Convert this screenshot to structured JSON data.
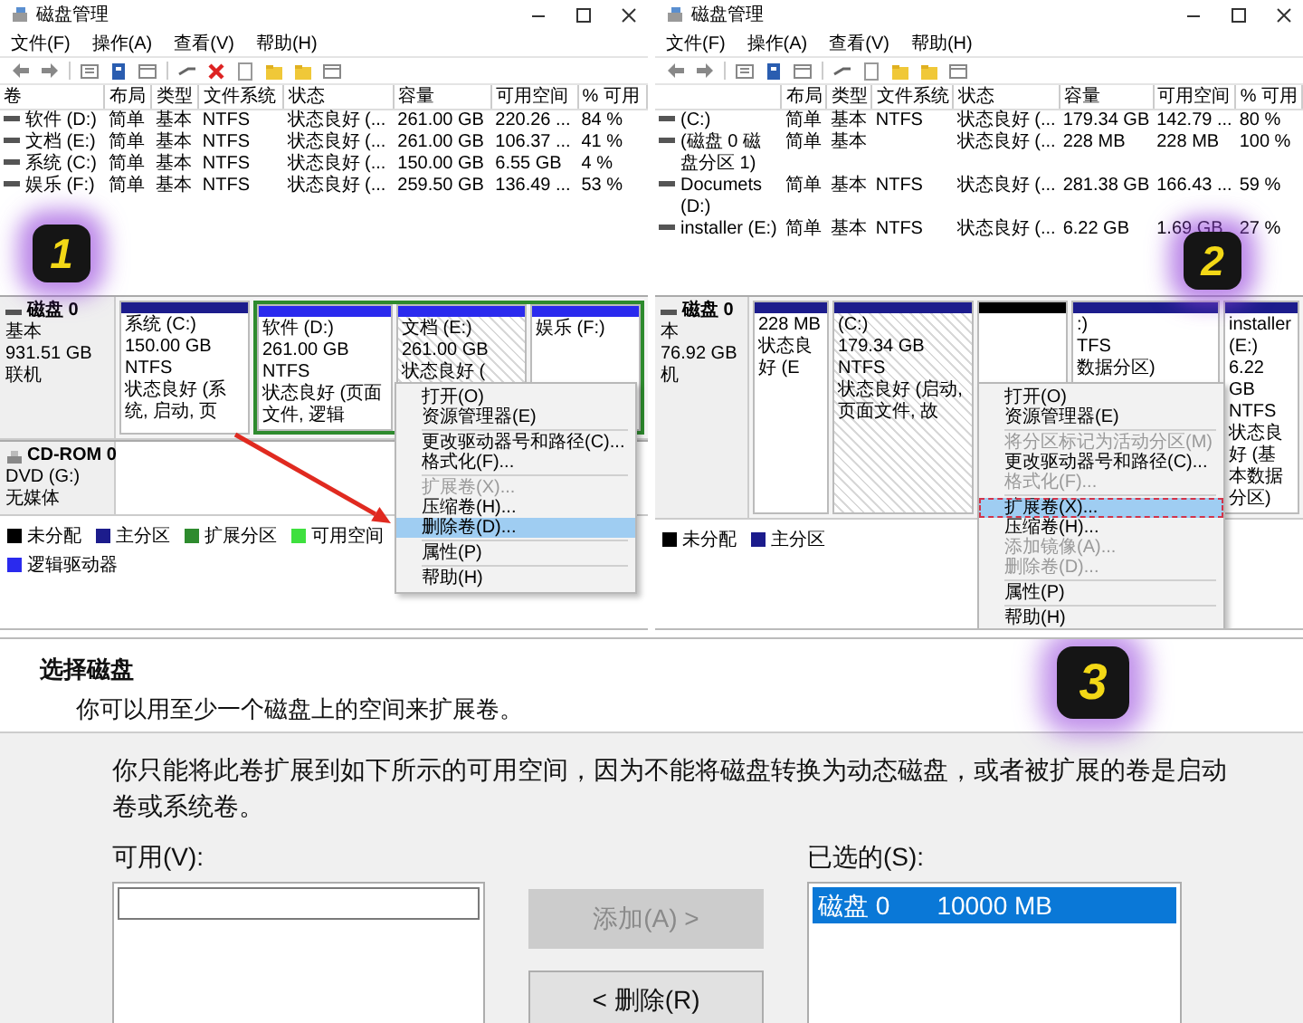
{
  "panels": [
    {
      "title": "磁盘管理",
      "menu": [
        "文件(F)",
        "操作(A)",
        "查看(V)",
        "帮助(H)"
      ],
      "volume_table": {
        "volume_column": "卷",
        "columns": [
          "布局",
          "类型",
          "文件系统",
          "状态",
          "容量",
          "可用空间",
          "% 可用"
        ],
        "rows": [
          {
            "volume": "软件 (D:)",
            "layout": "简单",
            "type": "基本",
            "file_system": "NTFS",
            "status": "状态良好 (...",
            "capacity": "261.00 GB",
            "free": "220.26 ...",
            "percent_free": "84 %"
          },
          {
            "volume": "文档 (E:)",
            "layout": "简单",
            "type": "基本",
            "file_system": "NTFS",
            "status": "状态良好 (...",
            "capacity": "261.00 GB",
            "free": "106.37 ...",
            "percent_free": "41 %"
          },
          {
            "volume": "系统 (C:)",
            "layout": "简单",
            "type": "基本",
            "file_system": "NTFS",
            "status": "状态良好 (...",
            "capacity": "150.00 GB",
            "free": "6.55 GB",
            "percent_free": "4 %"
          },
          {
            "volume": "娱乐 (F:)",
            "layout": "简单",
            "type": "基本",
            "file_system": "NTFS",
            "status": "状态良好 (...",
            "capacity": "259.50 GB",
            "free": "136.49 ...",
            "percent_free": "53 %"
          }
        ]
      },
      "disks": [
        {
          "kind": "disk",
          "lines": [
            "磁盘 0",
            "基本",
            "931.51 GB",
            "联机"
          ],
          "partitions": [
            {
              "kind": "primary",
              "name": "系统 (C:)",
              "lines": [
                "150.00 GB NTFS",
                "状态良好 (系统, 启动, 页"
              ],
              "selected": false
            },
            {
              "kind": "logical",
              "name": "软件 (D:)",
              "lines": [
                "261.00 GB NTFS",
                "状态良好 (页面文件, 逻辑"
              ],
              "selected": false
            },
            {
              "kind": "logical",
              "name": "文档 (E:)",
              "lines": [
                "261.00 GB",
                "状态良好 ("
              ],
              "selected": true
            },
            {
              "kind": "logical",
              "name": "娱乐 (F:)",
              "selected": false
            }
          ]
        },
        {
          "kind": "cdrom",
          "lines": [
            "CD-ROM 0",
            "DVD (G:)",
            "无媒体"
          ]
        }
      ],
      "legend": [
        {
          "label": "未分配",
          "color": "#000000"
        },
        {
          "label": "主分区",
          "color": "#1c1c8c"
        },
        {
          "label": "扩展分区",
          "color": "#2e8b2e"
        },
        {
          "label": "可用空间",
          "color": "#3ee03e"
        },
        {
          "label": "逻辑驱动器",
          "color": "#2a2aee"
        }
      ],
      "context_menu": {
        "items": [
          {
            "kind": "item",
            "label": "打开(O)",
            "disabled": false,
            "selected": false,
            "outlined": false
          },
          {
            "kind": "item",
            "label": "资源管理器(E)",
            "disabled": false,
            "selected": false,
            "outlined": false
          },
          {
            "kind": "separator"
          },
          {
            "kind": "item",
            "label": "更改驱动器号和路径(C)...",
            "disabled": false,
            "selected": false,
            "outlined": false
          },
          {
            "kind": "item",
            "label": "格式化(F)...",
            "disabled": false,
            "selected": false,
            "outlined": false
          },
          {
            "kind": "separator"
          },
          {
            "kind": "item",
            "label": "扩展卷(X)...",
            "disabled": true,
            "selected": false,
            "outlined": false
          },
          {
            "kind": "item",
            "label": "压缩卷(H)...",
            "disabled": false,
            "selected": false,
            "outlined": false
          },
          {
            "kind": "item",
            "label": "删除卷(D)...",
            "disabled": false,
            "selected": true,
            "outlined": false
          },
          {
            "kind": "separator"
          },
          {
            "kind": "item",
            "label": "属性(P)",
            "disabled": false,
            "selected": false,
            "outlined": false
          },
          {
            "kind": "separator"
          },
          {
            "kind": "item",
            "label": "帮助(H)",
            "disabled": false,
            "selected": false,
            "outlined": false
          }
        ]
      },
      "arrow": true,
      "badge": "1"
    },
    {
      "title": "磁盘管理",
      "menu": [
        "文件(F)",
        "操作(A)",
        "查看(V)",
        "帮助(H)"
      ],
      "volume_table": {
        "columns": [
          "布局",
          "类型",
          "文件系统",
          "状态",
          "容量",
          "可用空间",
          "% 可用"
        ],
        "rows": [
          {
            "volume": "(C:)",
            "layout": "简单",
            "type": "基本",
            "file_system": "NTFS",
            "status": "状态良好 (...",
            "capacity": "179.34 GB",
            "free": "142.79 ...",
            "percent_free": "80 %"
          },
          {
            "volume": "(磁盘 0 磁盘分区 1)",
            "layout": "简单",
            "type": "基本",
            "status": "状态良好 (...",
            "capacity": "228 MB",
            "free": "228 MB",
            "percent_free": "100 %"
          },
          {
            "volume": "Documets (D:)",
            "layout": "简单",
            "type": "基本",
            "file_system": "NTFS",
            "status": "状态良好 (...",
            "capacity": "281.38 GB",
            "free": "166.43 ...",
            "percent_free": "59 %"
          },
          {
            "volume": "installer (E:)",
            "layout": "简单",
            "type": "基本",
            "file_system": "NTFS",
            "status": "状态良好 (...",
            "capacity": "6.22 GB",
            "free": "1.69 GB",
            "percent_free": "27 %"
          }
        ]
      },
      "disks": [
        {
          "kind": "disk",
          "lines": [
            "磁盘 0",
            "本",
            "76.92 GB",
            "机"
          ],
          "partitions": [
            {
              "kind": "primary",
              "lines": [
                "228 MB",
                "状态良好 (E"
              ],
              "selected": false
            },
            {
              "kind": "primary",
              "name": "(C:)",
              "lines": [
                "179.34 GB NTFS",
                "状态良好 (启动, 页面文件, 故"
              ],
              "selected": true
            },
            {
              "kind": "unallocated",
              "selected": false
            },
            {
              "kind": "primary",
              "name": ":)",
              "lines": [
                "TFS",
                "数据分区)"
              ],
              "selected": false
            },
            {
              "kind": "primary",
              "name": "installer (E:)",
              "lines": [
                "6.22 GB NTFS",
                "状态良好 (基本数据分区)"
              ],
              "selected": false
            }
          ]
        }
      ],
      "legend": [
        {
          "label": "未分配",
          "color": "#000000"
        },
        {
          "label": "主分区",
          "color": "#1c1c8c"
        }
      ],
      "context_menu": {
        "items": [
          {
            "kind": "item",
            "label": "打开(O)",
            "disabled": false,
            "selected": false,
            "outlined": false
          },
          {
            "kind": "item",
            "label": "资源管理器(E)",
            "disabled": false,
            "selected": false,
            "outlined": false
          },
          {
            "kind": "separator"
          },
          {
            "kind": "item",
            "label": "将分区标记为活动分区(M)",
            "disabled": true,
            "selected": false,
            "outlined": false
          },
          {
            "kind": "item",
            "label": "更改驱动器号和路径(C)...",
            "disabled": false,
            "selected": false,
            "outlined": false
          },
          {
            "kind": "item",
            "label": "格式化(F)...",
            "disabled": true,
            "selected": false,
            "outlined": false
          },
          {
            "kind": "separator"
          },
          {
            "kind": "item",
            "label": "扩展卷(X)...",
            "disabled": false,
            "selected": true,
            "outlined": true
          },
          {
            "kind": "item",
            "label": "压缩卷(H)...",
            "disabled": false,
            "selected": false,
            "outlined": false
          },
          {
            "kind": "item",
            "label": "添加镜像(A)...",
            "disabled": true,
            "selected": false,
            "outlined": false
          },
          {
            "kind": "item",
            "label": "删除卷(D)...",
            "disabled": true,
            "selected": false,
            "outlined": false
          },
          {
            "kind": "separator"
          },
          {
            "kind": "item",
            "label": "属性(P)",
            "disabled": false,
            "selected": false,
            "outlined": false
          },
          {
            "kind": "separator"
          },
          {
            "kind": "item",
            "label": "帮助(H)",
            "disabled": false,
            "selected": false,
            "outlined": false
          }
        ]
      },
      "badge": "2"
    }
  ],
  "dialog": {
    "heading": "选择磁盘",
    "subheading": "你可以用至少一个磁盘上的空间来扩展卷。",
    "message": "你只能将此卷扩展到如下所示的可用空间，因为不能将磁盘转换为动态磁盘，或者被扩展的卷是启动卷或系统卷。",
    "available": {
      "label": "可用(V):"
    },
    "buttons": [
      {
        "label": "添加(A) >",
        "disabled": true
      },
      {
        "label": "< 删除(R)",
        "disabled": false
      }
    ],
    "selected_list": {
      "label": "已选的(S):",
      "items": [
        {
          "disk": "磁盘 0",
          "size": "10000 MB",
          "selected": true
        }
      ]
    },
    "badge": "3"
  }
}
